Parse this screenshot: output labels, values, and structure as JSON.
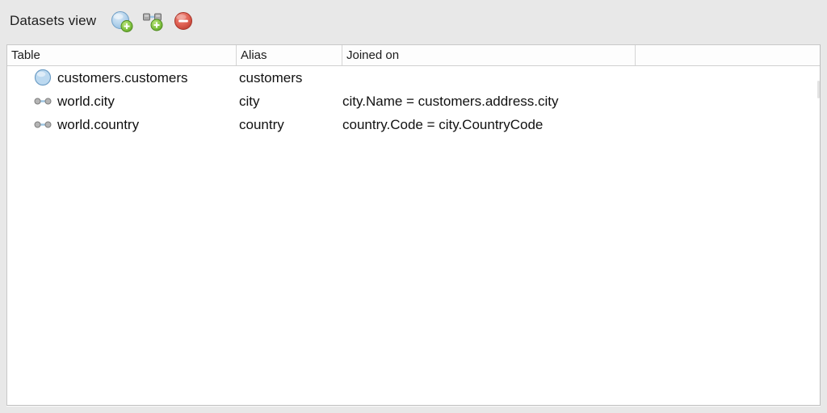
{
  "toolbar": {
    "title": "Datasets view",
    "buttons": [
      {
        "name": "add-dataset-button",
        "icon": "blue-sphere-plus-icon",
        "label": "Add dataset"
      },
      {
        "name": "add-join-button",
        "icon": "join-nodes-plus-icon",
        "label": "Add join"
      },
      {
        "name": "remove-button",
        "icon": "red-minus-circle-icon",
        "label": "Remove"
      }
    ]
  },
  "table": {
    "columns": [
      "Table",
      "Alias",
      "Joined on",
      ""
    ],
    "rows": [
      {
        "icon": "blue-circle-icon",
        "table": "customers.customers",
        "alias": "customers",
        "joined_on": ""
      },
      {
        "icon": "join-link-icon",
        "table": "world.city",
        "alias": "city",
        "joined_on": "city.Name = customers.address.city"
      },
      {
        "icon": "join-link-icon",
        "table": "world.country",
        "alias": "country",
        "joined_on": "country.Code = city.CountryCode"
      }
    ]
  },
  "colors": {
    "window_bg": "#e8e8e8",
    "panel_bg": "#ffffff",
    "panel_border": "#c8c8c8",
    "text": "#111111",
    "header_text": "#1b1b1b",
    "sphere_blue": "#a7c8e8",
    "sphere_blue_border": "#6e9ec6",
    "badge_green": "#7cc043",
    "remove_red": "#d94f45",
    "join_node_gray": "#8a8a8a",
    "join_line_blue": "#9bc4e2"
  }
}
